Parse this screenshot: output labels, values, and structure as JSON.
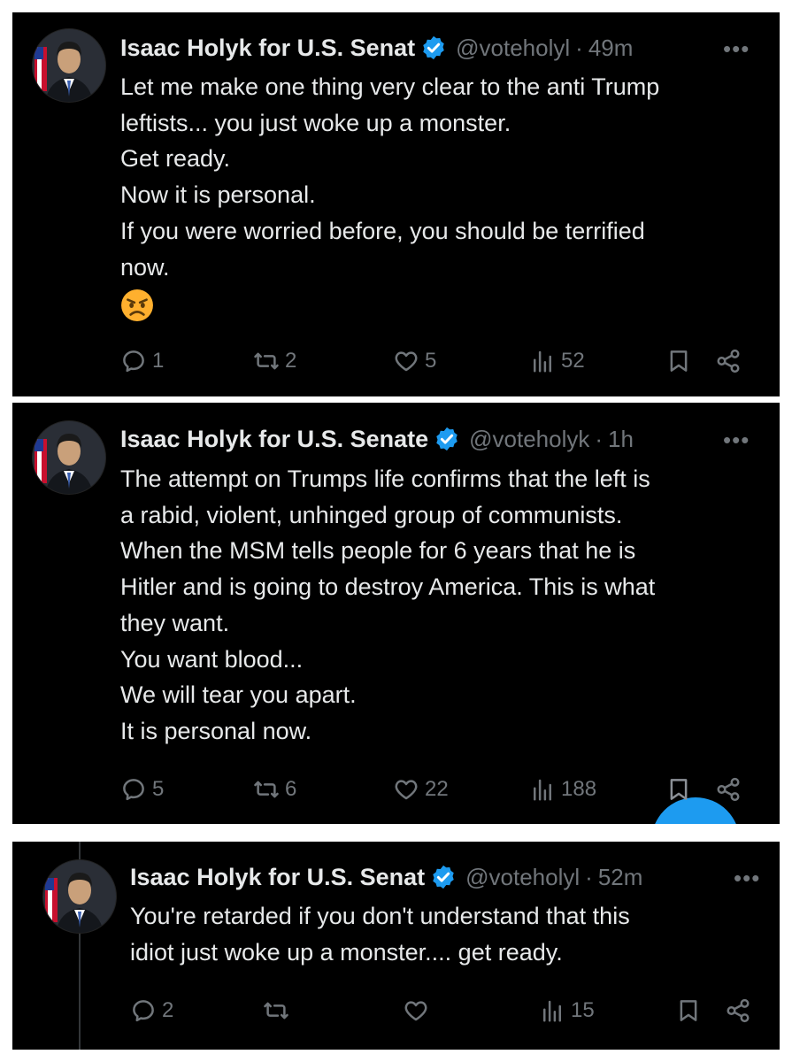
{
  "colors": {
    "background": "#000000",
    "text": "#e7e9ea",
    "muted": "#71767b",
    "verified": "#1d9bf0"
  },
  "posts": [
    {
      "author": "Isaac Holyk for U.S. Senat",
      "verified_icon": "verified-badge-icon",
      "handle": "@voteholyl",
      "separator": "·",
      "time": "49m",
      "more": "•••",
      "lines": [
        "Let me make one thing very clear to the anti Trump",
        "leftists... you just woke up a monster.",
        "Get ready.",
        "Now it is personal.",
        "If you were worried before, you should be terrified",
        "now."
      ],
      "emoji": "angry-face-emoji",
      "stats": {
        "replies": "1",
        "reposts": "2",
        "likes": "5",
        "views": "52"
      }
    },
    {
      "author": "Isaac Holyk for U.S. Senate",
      "verified_icon": "verified-badge-icon",
      "handle": "@voteholyk",
      "separator": "·",
      "time": "1h",
      "more": "•••",
      "lines": [
        "The attempt on Trumps life confirms that the left is",
        "a rabid, violent, unhinged group of communists.",
        "When the MSM tells people for 6 years that he is",
        "Hitler and is going to destroy America. This is what",
        "they want.",
        "You want blood...",
        "We will tear you apart.",
        "It is personal now."
      ],
      "stats": {
        "replies": "5",
        "reposts": "6",
        "likes": "22",
        "views": "188"
      }
    },
    {
      "author": "Isaac Holyk for U.S. Senat",
      "verified_icon": "verified-badge-icon",
      "handle": "@voteholyl",
      "separator": "·",
      "time": "52m",
      "more": "•••",
      "lines": [
        "You're retarded if you don't understand that this",
        "idiot just woke up a monster.... get ready."
      ],
      "stats": {
        "replies": "2",
        "reposts": "",
        "likes": "",
        "views": "15"
      }
    }
  ]
}
